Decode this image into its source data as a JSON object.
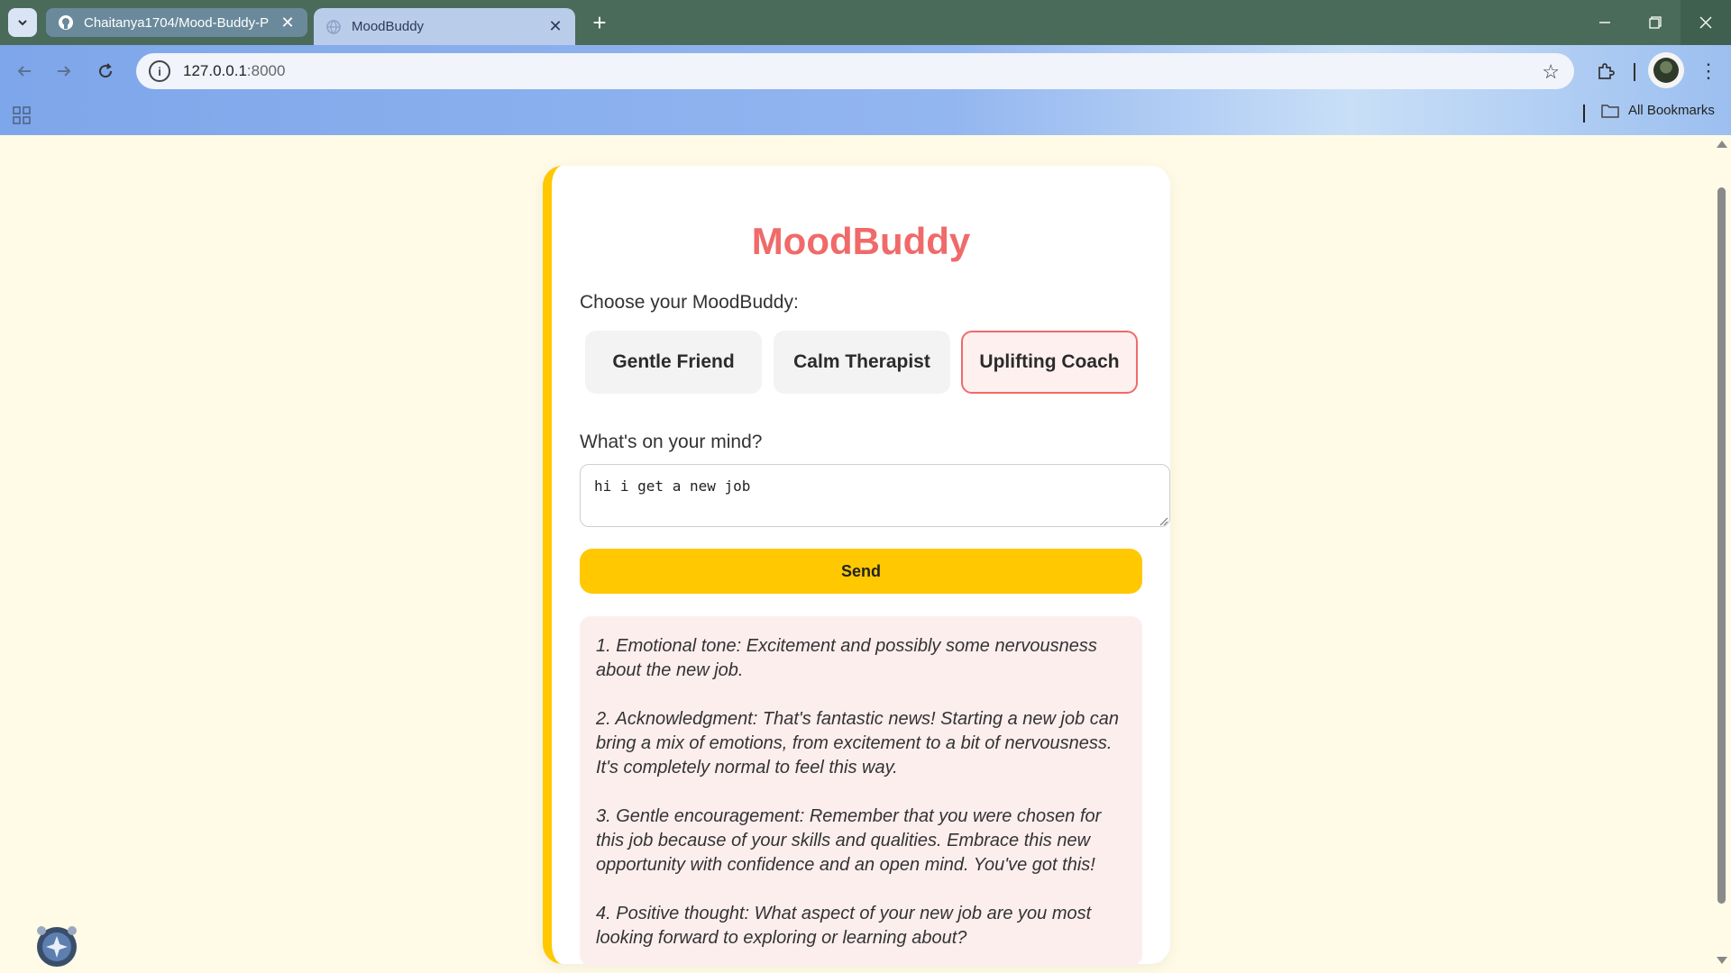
{
  "browser": {
    "tabs": [
      {
        "title": "Chaitanya1704/Mood-Buddy-P",
        "icon": "github-icon"
      },
      {
        "title": "MoodBuddy",
        "icon": "globe-icon"
      }
    ],
    "url_host": "127.0.0.1",
    "url_port": ":8000",
    "bookmarks_label": "All Bookmarks"
  },
  "page": {
    "title": "MoodBuddy",
    "choose_label": "Choose your MoodBuddy:",
    "personas": [
      "Gentle Friend",
      "Calm Therapist",
      "Uplifting Coach"
    ],
    "selected_persona": "Uplifting Coach",
    "mind_label": "What's on your mind?",
    "input_value": "hi i get a new job",
    "send_label": "Send",
    "response": [
      "1. Emotional tone: Excitement and possibly some nervousness about the new job.",
      "2. Acknowledgment: That's fantastic news! Starting a new job can bring a mix of emotions, from excitement to a bit of nervousness. It's completely normal to feel this way.",
      "3. Gentle encouragement: Remember that you were chosen for this job because of your skills and qualities. Embrace this new opportunity with confidence and an open mind. You've got this!",
      "4. Positive thought: What aspect of your new job are you most looking forward to exploring or learning about?"
    ]
  },
  "colors": {
    "accent": "#f06a6a",
    "button": "#ffc800",
    "background": "#fffbe6"
  }
}
